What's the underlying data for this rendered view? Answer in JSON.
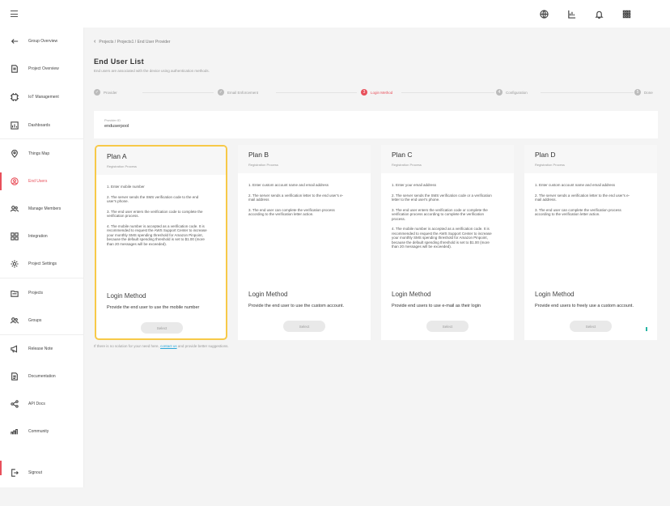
{
  "topbar": {
    "icons": [
      "globe-icon",
      "tasks-icon",
      "bell-icon",
      "apps-grid-icon"
    ]
  },
  "sidebar": {
    "items": [
      {
        "label": "Group Overview",
        "icon": "back-arrow-icon"
      },
      {
        "label": "Project Overview",
        "icon": "file-icon"
      },
      {
        "label": "IoT Management",
        "icon": "iot-icon"
      },
      {
        "label": "Dashboards",
        "icon": "dashboard-icon"
      },
      {
        "label": "Things Map",
        "icon": "map-pin-icon"
      },
      {
        "label": "End Users",
        "icon": "user-circle-icon",
        "active": true
      },
      {
        "label": "Manage Members",
        "icon": "members-icon"
      },
      {
        "label": "Integration",
        "icon": "integration-icon"
      },
      {
        "label": "Project Settings",
        "icon": "settings-icon"
      },
      {
        "label": "Projects",
        "icon": "projects-icon"
      },
      {
        "label": "Groups",
        "icon": "groups-icon"
      },
      {
        "label": "Release Note",
        "icon": "megaphone-icon"
      },
      {
        "label": "Documentation",
        "icon": "document-icon"
      },
      {
        "label": "API Docs",
        "icon": "share-icon"
      },
      {
        "label": "Community",
        "icon": "community-icon"
      },
      {
        "label": "Signout",
        "icon": "signout-icon"
      }
    ]
  },
  "main": {
    "breadcrumb": "Projects / Projects1 / End User Provider",
    "title": "End User List",
    "description": "End users are associated with the device using authentication methods.",
    "steps": [
      {
        "num": "✓",
        "label": "Provider"
      },
      {
        "num": "✓",
        "label": "Email Enforcement"
      },
      {
        "num": "3",
        "label": "Login Method"
      },
      {
        "num": "4",
        "label": "Configuration"
      },
      {
        "num": "5",
        "label": "Done"
      }
    ],
    "current_step": 3,
    "field": {
      "label": "Provider ID",
      "value": "enduserpool"
    },
    "login_method_title": "Login Method",
    "select_label": "Select",
    "plans": [
      {
        "name": "Plan A",
        "subtitle": "Registration Process",
        "selected": true,
        "steps": [
          "1. Enter mobile number",
          "2. The server sends the SMS verification code to the end user's phone.",
          "3. The end user enters the verification code to complete the verification process.",
          "4. The mobile number is accepted as a verification code. It is recommended to request the AWS Support Center to increase your monthly SMS spending threshold for Amazon Pinpoint, because the default spending threshold is set to $1.00 (more than 20 messages will be exceeded)."
        ],
        "login_desc": "Provide the end user to use the mobile number"
      },
      {
        "name": "Plan B",
        "subtitle": "Registration Process",
        "selected": false,
        "steps": [
          "1. Enter custom account name and email address",
          "2. The server sends a verification letter to the end user's e-mail address",
          "3. The end user can complete the verification process according to the verification letter action."
        ],
        "login_desc": "Provide the end user to use the custom account."
      },
      {
        "name": "Plan C",
        "subtitle": "Registration Process",
        "selected": false,
        "steps": [
          "1. Enter your email address",
          "2. The server sends the SMS verification code or a verification letter to the end user's phone.",
          "3. The end user enters the verification code or complete the verification process according to complete the verification process.",
          "4. The mobile number is accepted as a verification code. It is recommended to request the AWS Support Center to increase your monthly SMS spending threshold for Amazon Pinpoint, because the default spending threshold is set to $1.00 (more than 20 messages will be exceeded)."
        ],
        "login_desc": "Provide end users to use e-mail as their login"
      },
      {
        "name": "Plan D",
        "subtitle": "Registration Process",
        "selected": false,
        "steps": [
          "1. Enter custom account name and email address",
          "2. The server sends a verification letter to the end user's e-mail address.",
          "3. The end user can complete the verification process according to the verification letter action."
        ],
        "login_desc": "Provide end users to freely use a custom account."
      }
    ],
    "note": {
      "before": "If there is no solution for your need here,",
      "link": "contact us",
      "after": "and provide better suggestions."
    }
  }
}
